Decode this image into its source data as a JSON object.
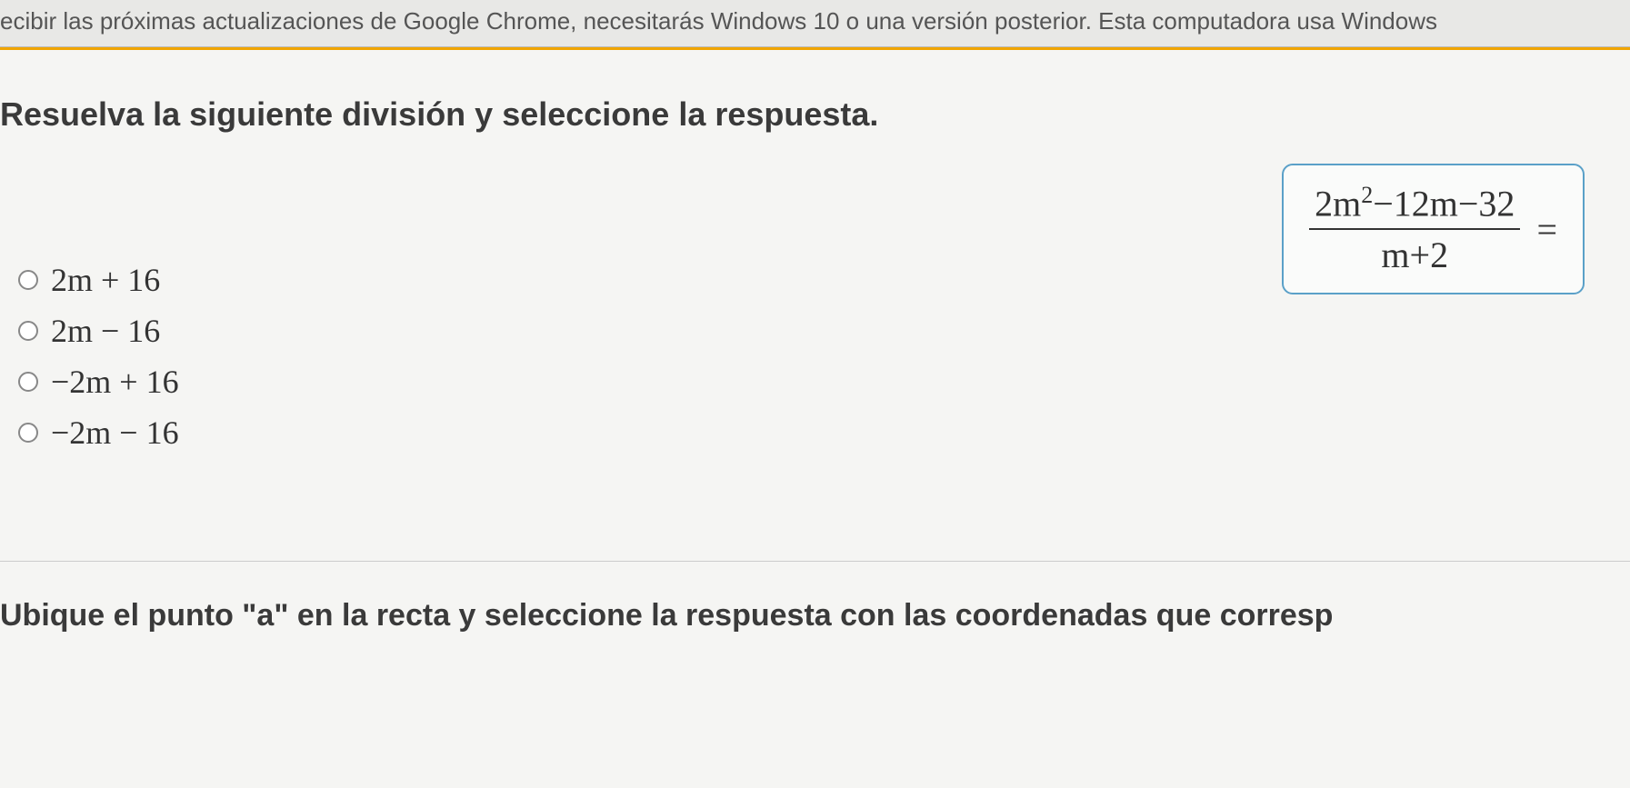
{
  "notification": "ecibir las próximas actualizaciones de Google Chrome, necesitarás Windows 10 o una versión posterior. Esta computadora usa Windows",
  "question": {
    "title": "Resuelva la siguiente división y seleccione la respuesta.",
    "formula": {
      "numerator_a": "2m",
      "numerator_exp": "2",
      "numerator_b": "−12m−32",
      "denominator": "m+2",
      "equals": "="
    }
  },
  "options": [
    {
      "label": "2m + 16"
    },
    {
      "label": "2m − 16"
    },
    {
      "label": "−2m + 16"
    },
    {
      "label": "−2m − 16"
    }
  ],
  "footer": "Ubique el punto \"a\" en la recta y seleccione la respuesta con las coordenadas que corresp"
}
